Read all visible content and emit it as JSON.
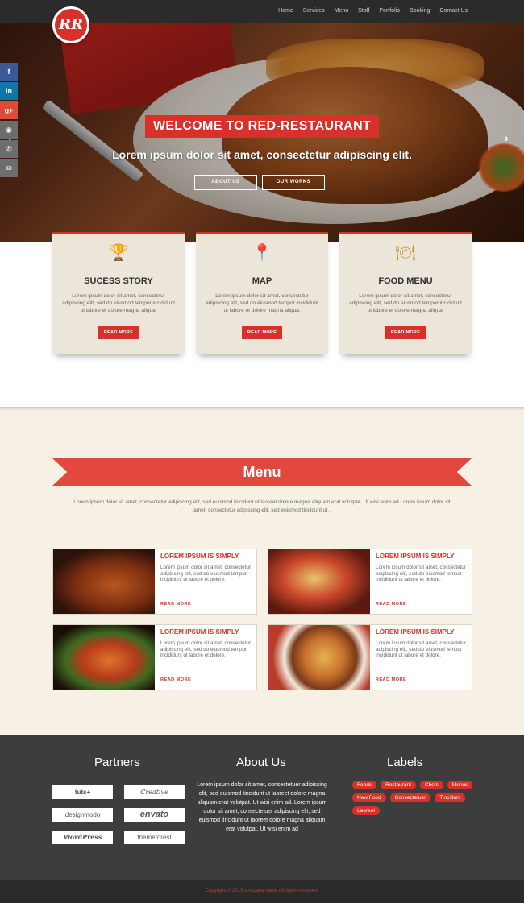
{
  "brand": {
    "logo_text": "RR",
    "accent": "#d9302a"
  },
  "nav": [
    "Home",
    "Services",
    "Menu",
    "Staff",
    "Portfolio",
    "Booking",
    "Contact Us"
  ],
  "social": [
    {
      "icon": "facebook-icon",
      "glyph": "f",
      "color": "#3b5998"
    },
    {
      "icon": "linkedin-icon",
      "glyph": "in",
      "color": "#0e76a8"
    },
    {
      "icon": "google-plus-icon",
      "glyph": "g+",
      "color": "#dd4b39"
    },
    {
      "icon": "github-icon",
      "glyph": "◉",
      "color": "#6d6d6d"
    },
    {
      "icon": "phone-icon",
      "glyph": "✆",
      "color": "#6d6d6d"
    },
    {
      "icon": "mail-icon",
      "glyph": "✉",
      "color": "#6d6d6d"
    }
  ],
  "hero": {
    "title": "WELCOME TO RED-RESTAURANT",
    "subtitle": "Lorem ipsum dolor sit amet, consectetur adipiscing elit.",
    "btn_about": "ABOUT US",
    "btn_works": "OUR WORKS",
    "prev_arrow": "‹",
    "next_arrow": "›"
  },
  "features": [
    {
      "icon": "trophy-icon",
      "glyph": "🏆",
      "title": "SUCESS STORY",
      "text": "Lorem ipsum dolor sit amet, consectetur adipiscing elit, sed do eiusmod tempor incididunt ut labore et dolore magna aliqua.",
      "btn": "READ MORE"
    },
    {
      "icon": "map-pin-icon",
      "glyph": "📍",
      "title": "MAP",
      "text": "Lorem ipsum dolor sit amet, consectetur adipiscing elit, sed do eiusmod tempor incididunt ut labore et dolore magna aliqua.",
      "btn": "READ MORE"
    },
    {
      "icon": "plate-cutlery-icon",
      "glyph": "🍽",
      "title": "FOOD MENU",
      "text": "Lorem ipsum dolor sit amet, consectetur adipiscing elit, sed do eiusmod tempor incididunt ut labore et dolore magna aliqua.",
      "btn": "READ MORE"
    }
  ],
  "menu": {
    "title": "Menu",
    "intro": "Lorem ipsum dolor sit amet, consectetur adipiscing elit, sed euismod tincidunt ut laoreet dolore magna aliquam erat volutpat. Ut wisi enim ad.Lorem ipsum dolor sit amet, consectetur adipiscing elit, sed euismod tincidunt ut .",
    "items": [
      {
        "title": "LOREM IPSUM IS SIMPLY",
        "text": "Lorem ipsum dolor sit amet, consectetur adipiscing elit, sed do eiusmod tempor incididunt ut labore et dolore.",
        "link": "READ MORE"
      },
      {
        "title": "LOREM IPSUM IS SIMPLY",
        "text": "Lorem ipsum dolor sit amet, consectetur adipiscing elit, sed do eiusmod tempor incididunt ut labore et dolore.",
        "link": "READ MORE"
      },
      {
        "title": "LOREM IPSUM IS SIMPLY",
        "text": "Lorem ipsum dolor sit amet, consectetur adipiscing elit, sed do eiusmod tempor incididunt ut labore et dolore.",
        "link": "READ MORE"
      },
      {
        "title": "LOREM IPSUM IS SIMPLY",
        "text": "Lorem ipsum dolor sit amet, consectetur adipiscing elit, sed do eiusmod tempor incididunt ut labore et dolore.",
        "link": "READ MORE"
      }
    ]
  },
  "footer": {
    "partners_title": "Partners",
    "partners": [
      "tuts+",
      "Creative",
      "designmodo",
      "envato",
      "WordPress",
      "themeforest"
    ],
    "about_title": "About Us",
    "about_text": "Lorem ipsum dolor sit amet, consectetuer adipiscing elit, sed euismod tincidunt ut laoreet dolore magna aliquam erat volutpat. Ut wisi enim ad. Lorem ipsum dolor sit amet, consectetuer adipiscing elit, sed euismod tincidunt ut laoreet dolore magna aliquam erat volutpat. Ut wisi enim ad",
    "labels_title": "Labels",
    "labels": [
      "Foods",
      "Restaurant",
      "Chefs",
      "Menus",
      "New Food",
      "Consectetuer",
      "Tincidunt",
      "Laoreet"
    ],
    "copyright": "Copyright © 2015 company name All rights reserved."
  }
}
